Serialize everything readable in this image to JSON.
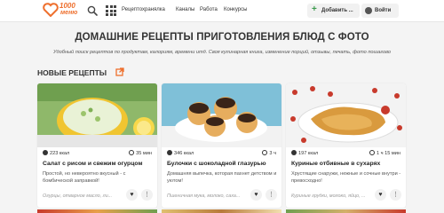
{
  "logo": {
    "top": "1000",
    "bottom": "меню"
  },
  "nav": {
    "items": [
      "Рецептохранялка",
      "Каналы",
      "Работа",
      "Конкурсы"
    ]
  },
  "buttons": {
    "add": "Добавить ...",
    "login": "Войти"
  },
  "heading": {
    "title": "ДОМАШНИЕ РЕЦЕПТЫ ПРИГОТОВЛЕНИЯ БЛЮД С ФОТО",
    "subtitle": "Удобный поиск рецептов по продуктам, калориям, времени итд. Своя кулинарная книга, изменение порций, отзывы, печать, фото пошагово"
  },
  "section": {
    "title": "НОВЫЕ РЕЦЕПТЫ"
  },
  "cards": [
    {
      "kcal": "223 ккал",
      "time": "35 мин",
      "title": "Салат с рисом и свежим огурцом",
      "desc": "Простой, но невероятно вкусный - с бомбической заправкой!",
      "ingredients": "Огурцы, отварное масло, ли...",
      "colors": [
        "#b9d88a",
        "#f5c43a",
        "#5a8f3a"
      ]
    },
    {
      "kcal": "346 ккал",
      "time": "3 ч",
      "title": "Булочки с шоколадной глазурью",
      "desc": "Домашняя выпечка, которая пахнет детством и уютом!",
      "ingredients": "Пшеничная мука, молоко, саха...",
      "colors": [
        "#e8b46a",
        "#3a2418",
        "#5da9c8"
      ]
    },
    {
      "kcal": "197 ккал",
      "time": "1 ч 15 мин",
      "title": "Куриные отбивные в сухарях",
      "desc": "Хрустящие снаружи, нежные и сочные внутри - превосходно!",
      "ingredients": "Куриные грудки, молоко, яйцо, ...",
      "colors": [
        "#d99a3e",
        "#c83a2c",
        "#ffffff"
      ]
    }
  ],
  "icons": {
    "search": "search-icon",
    "grid": "grid-icon",
    "plus": "plus-icon",
    "user": "user-icon",
    "external": "external-link-icon",
    "heart": "heart-icon",
    "more": "more-icon"
  },
  "accent": "#ee6f2d"
}
